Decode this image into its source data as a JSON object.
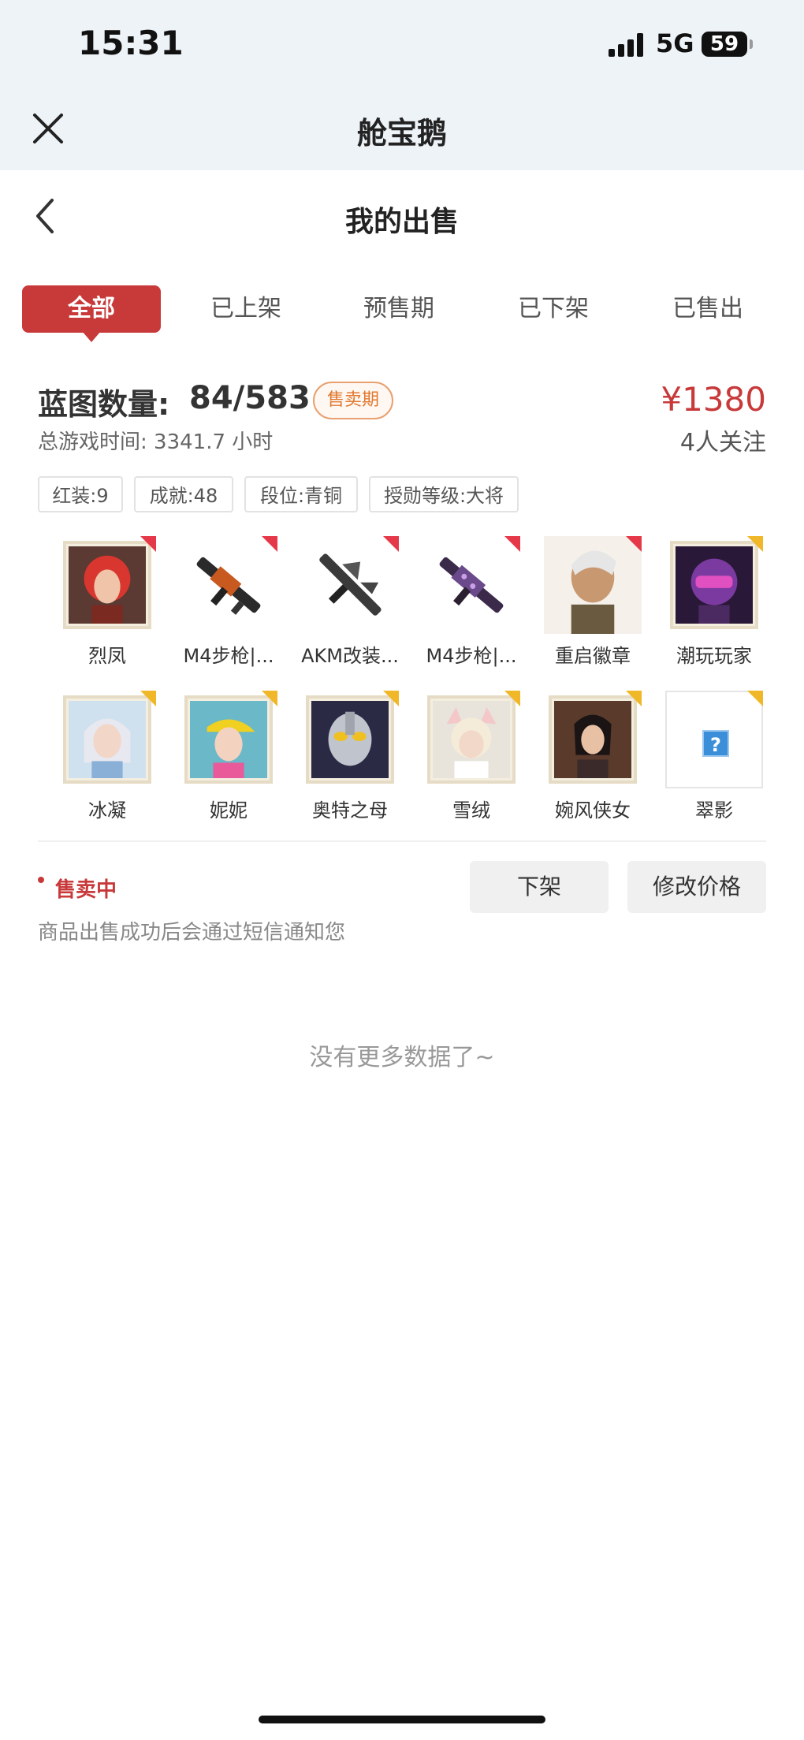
{
  "status_bar": {
    "time": "15:31",
    "network": "5G",
    "battery": "59"
  },
  "app_header": {
    "title": "舱宝鹅"
  },
  "page": {
    "title": "我的出售"
  },
  "tabs": [
    "全部",
    "已上架",
    "预售期",
    "已下架",
    "已售出"
  ],
  "active_tab": "全部",
  "listing": {
    "blueprint_label": "蓝图数量:",
    "blueprint_count": "84/583",
    "sale_badge": "售卖期",
    "price": "¥1380",
    "game_time": "总游戏时间: 3341.7 小时",
    "followers": "4人关注",
    "tags": [
      "红装:9",
      "成就:48",
      "段位:青铜",
      "授勋等级:大将"
    ],
    "items": [
      {
        "name": "烈凤",
        "icon": "red-hair-character-icon",
        "corner": "red"
      },
      {
        "name": "M4步枪|...",
        "icon": "rifle-icon",
        "corner": "red"
      },
      {
        "name": "AKM改装...",
        "icon": "rifle-icon",
        "corner": "red"
      },
      {
        "name": "M4步枪|...",
        "icon": "rifle-icon",
        "corner": "red"
      },
      {
        "name": "重启徽章",
        "icon": "character-icon",
        "corner": "red"
      },
      {
        "name": "潮玩玩家",
        "icon": "helmet-character-icon",
        "corner": "gold"
      },
      {
        "name": "冰凝",
        "icon": "character-icon",
        "corner": "gold"
      },
      {
        "name": "妮妮",
        "icon": "character-icon",
        "corner": "gold"
      },
      {
        "name": "奥特之母",
        "icon": "ultra-mask-icon",
        "corner": "gold"
      },
      {
        "name": "雪绒",
        "icon": "character-icon",
        "corner": "gold"
      },
      {
        "name": "婉风侠女",
        "icon": "character-icon",
        "corner": "gold"
      },
      {
        "name": "翠影",
        "icon": "unknown-item-icon",
        "corner": "gold",
        "glyph": "?"
      }
    ],
    "status": "售卖中",
    "notice": "商品出售成功后会通过短信通知您",
    "unlist_button": "下架",
    "edit_price_button": "修改价格"
  },
  "no_more": "没有更多数据了~"
}
